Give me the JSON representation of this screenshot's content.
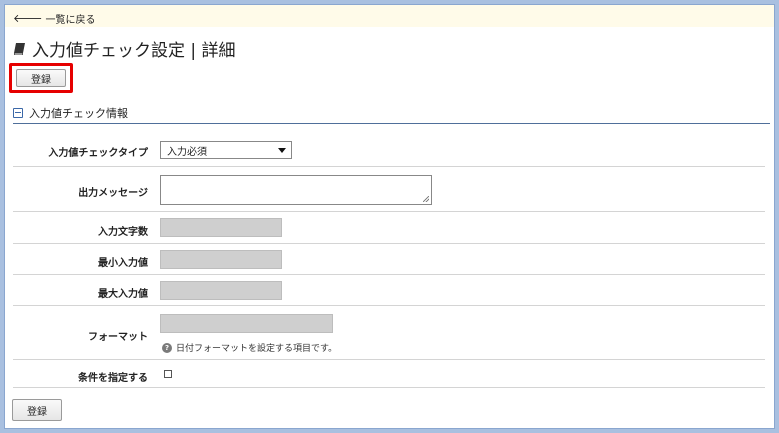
{
  "header": {
    "back_link": "一覧に戻る",
    "title": "入力値チェック設定 | 詳細"
  },
  "toolbar": {
    "register_label": "登録"
  },
  "section": {
    "title": "入力値チェック情報"
  },
  "form": {
    "check_type": {
      "label": "入力値チェックタイプ",
      "value": "入力必須"
    },
    "output_message": {
      "label": "出力メッセージ",
      "value": ""
    },
    "input_length": {
      "label": "入力文字数"
    },
    "min_value": {
      "label": "最小入力値"
    },
    "max_value": {
      "label": "最大入力値"
    },
    "format": {
      "label": "フォーマット",
      "hint": "日付フォーマットを設定する項目です。"
    },
    "condition": {
      "label": "条件を指定する",
      "checked": false
    }
  },
  "footer": {
    "register_label": "登録"
  },
  "colors": {
    "highlight": "#e60000",
    "topbar_bg": "#fffbe9",
    "section_rule": "#4f6f9a",
    "disabled_input": "#cfcfcf"
  }
}
